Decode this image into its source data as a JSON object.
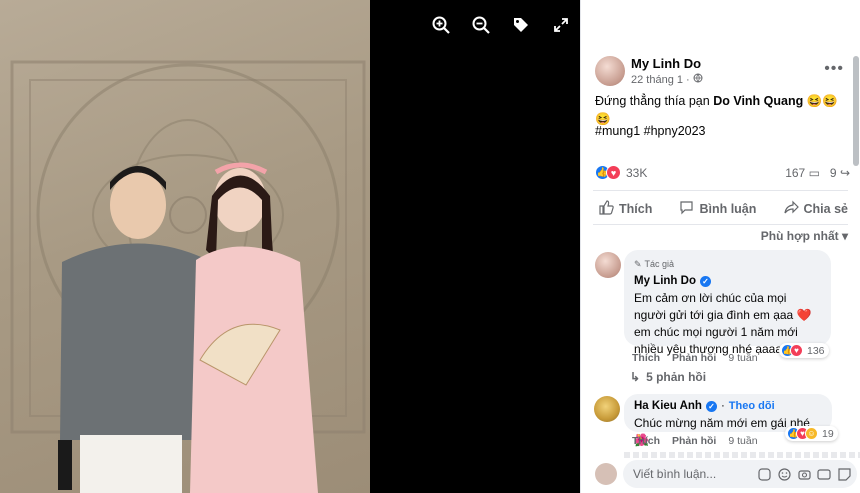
{
  "post": {
    "author": "My Linh Do",
    "date": "22 tháng 1",
    "text_prefix": "Đứng thẳng thía pạn",
    "mention": "Do Vinh Quang",
    "text_emojis": "😆😆😆",
    "hashtags": "#mung1 #hpny2023",
    "reaction_count": "33K",
    "comment_count": "167",
    "share_count": "9"
  },
  "actions": {
    "like": "Thích",
    "comment": "Bình luận",
    "share": "Chia sẻ"
  },
  "sort_label": "Phù hợp nhất",
  "comments": [
    {
      "badge": "Tác giả",
      "name": "My Linh Do",
      "text_a": "Em cảm ơn lời chúc của mọi người gửi tới gia đình em ạaa",
      "text_b": "em chúc mọi người 1 năm mới nhiều yêu thương nhé ạaaaa",
      "like": "Thích",
      "reply": "Phản hồi",
      "time": "9 tuần",
      "react_count": "136"
    },
    {
      "name": "Ha Kieu Anh",
      "follow": "Theo dõi",
      "text": "Chúc mừng năm mới em gái nhé",
      "like": "Thích",
      "reply": "Phản hồi",
      "time": "9 tuần",
      "react_count": "19"
    }
  ],
  "replies_label": "5 phản hồi",
  "composer_placeholder": "Viết bình luận...",
  "colors": {
    "accent": "#1877f2",
    "love": "#f33e58",
    "haha": "#f7b928",
    "muted": "#65676b"
  }
}
